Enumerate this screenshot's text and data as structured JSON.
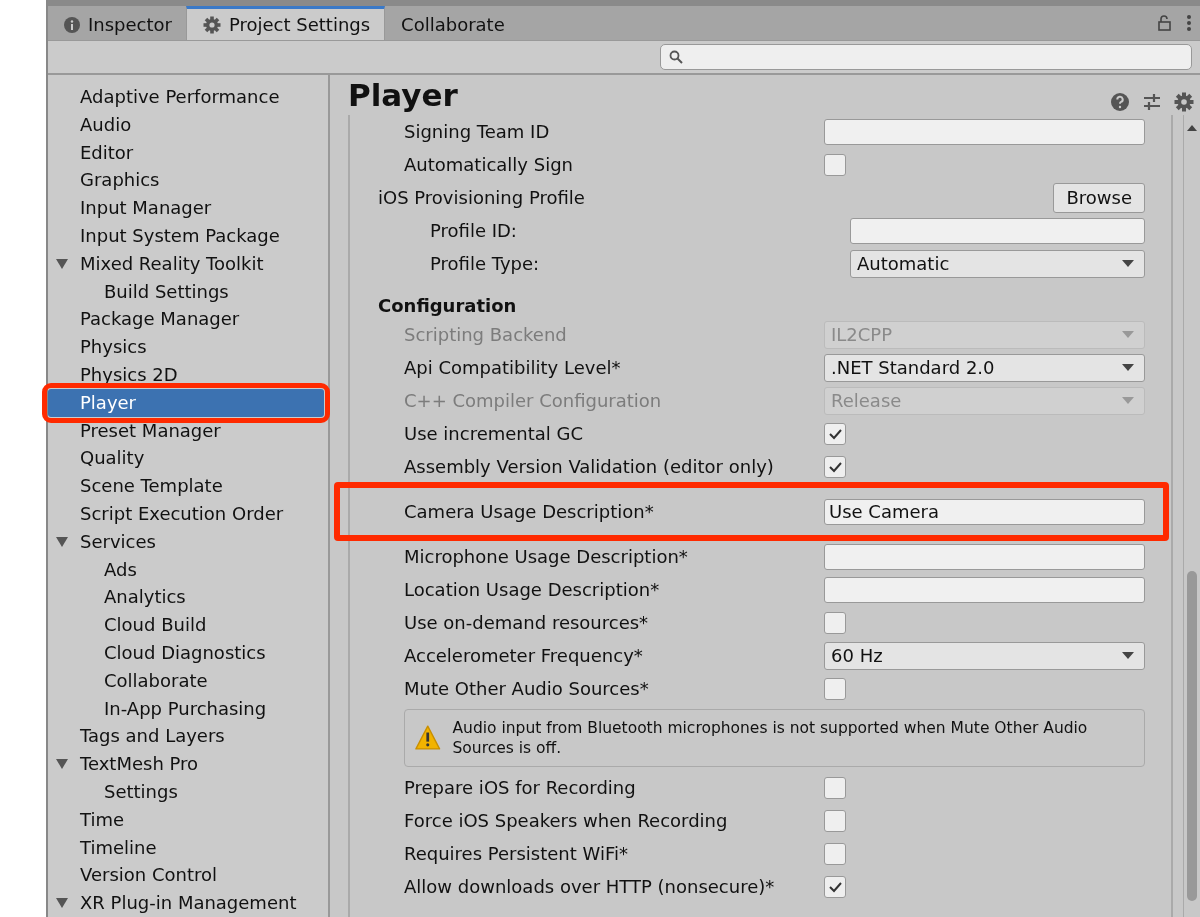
{
  "tabs": [
    {
      "label": "Inspector",
      "selected": false
    },
    {
      "label": "Project Settings",
      "selected": true
    },
    {
      "label": "Collaborate",
      "selected": false
    }
  ],
  "sidebar": {
    "items": [
      {
        "label": "Adaptive Performance",
        "selected": false
      },
      {
        "label": "Audio",
        "selected": false
      },
      {
        "label": "Editor",
        "selected": false
      },
      {
        "label": "Graphics",
        "selected": false
      },
      {
        "label": "Input Manager",
        "selected": false
      },
      {
        "label": "Input System Package",
        "selected": false
      },
      {
        "label": "Mixed Reality Toolkit",
        "selected": false,
        "expanded": true,
        "children": [
          {
            "label": "Build Settings",
            "selected": false
          }
        ]
      },
      {
        "label": "Package Manager",
        "selected": false
      },
      {
        "label": "Physics",
        "selected": false
      },
      {
        "label": "Physics 2D",
        "selected": false
      },
      {
        "label": "Player",
        "selected": true,
        "annotated": true
      },
      {
        "label": "Preset Manager",
        "selected": false
      },
      {
        "label": "Quality",
        "selected": false
      },
      {
        "label": "Scene Template",
        "selected": false
      },
      {
        "label": "Script Execution Order",
        "selected": false
      },
      {
        "label": "Services",
        "selected": false,
        "expanded": true,
        "children": [
          {
            "label": "Ads",
            "selected": false
          },
          {
            "label": "Analytics",
            "selected": false
          },
          {
            "label": "Cloud Build",
            "selected": false
          },
          {
            "label": "Cloud Diagnostics",
            "selected": false
          },
          {
            "label": "Collaborate",
            "selected": false
          },
          {
            "label": "In-App Purchasing",
            "selected": false
          }
        ]
      },
      {
        "label": "Tags and Layers",
        "selected": false
      },
      {
        "label": "TextMesh Pro",
        "selected": false,
        "expanded": true,
        "children": [
          {
            "label": "Settings",
            "selected": false
          }
        ]
      },
      {
        "label": "Time",
        "selected": false
      },
      {
        "label": "Timeline",
        "selected": false
      },
      {
        "label": "Version Control",
        "selected": false
      },
      {
        "label": "XR Plug-in Management",
        "selected": false,
        "expanded": true
      }
    ]
  },
  "panel": {
    "title": "Player",
    "rows": [
      {
        "kind": "field",
        "label": "Signing Team ID",
        "value": ""
      },
      {
        "kind": "checkbox",
        "label": "Automatically Sign",
        "checked": false
      },
      {
        "kind": "button",
        "label": "iOS Provisioning Profile",
        "button": "Browse"
      },
      {
        "kind": "field",
        "label": "Profile ID:",
        "value": ""
      },
      {
        "kind": "dropdown",
        "label": "Profile Type:",
        "value": "Automatic",
        "disabled": false
      },
      {
        "kind": "header",
        "label": "Configuration"
      },
      {
        "kind": "dropdown",
        "label": "Scripting Backend",
        "value": "IL2CPP",
        "disabled": true
      },
      {
        "kind": "dropdown",
        "label": "Api Compatibility Level*",
        "value": ".NET Standard 2.0",
        "disabled": false
      },
      {
        "kind": "dropdown",
        "label": "C++ Compiler Configuration",
        "value": "Release",
        "disabled": true
      },
      {
        "kind": "checkbox",
        "label": "Use incremental GC",
        "checked": true
      },
      {
        "kind": "checkbox",
        "label": "Assembly Version Validation (editor only)",
        "checked": true
      },
      {
        "kind": "field",
        "label": "Camera Usage Description*",
        "value": "Use Camera",
        "annotated": true
      },
      {
        "kind": "field",
        "label": "Microphone Usage Description*",
        "value": ""
      },
      {
        "kind": "field",
        "label": "Location Usage Description*",
        "value": ""
      },
      {
        "kind": "checkbox",
        "label": "Use on-demand resources*",
        "checked": false
      },
      {
        "kind": "dropdown",
        "label": "Accelerometer Frequency*",
        "value": "60 Hz",
        "disabled": false
      },
      {
        "kind": "checkbox",
        "label": "Mute Other Audio Sources*",
        "checked": false
      },
      {
        "kind": "warning",
        "text": "Audio input from Bluetooth microphones is not supported when Mute Other Audio Sources is off."
      },
      {
        "kind": "checkbox",
        "label": "Prepare iOS for Recording",
        "checked": false
      },
      {
        "kind": "checkbox",
        "label": "Force iOS Speakers when Recording",
        "checked": false
      },
      {
        "kind": "checkbox",
        "label": "Requires Persistent WiFi*",
        "checked": false
      },
      {
        "kind": "checkbox",
        "label": "Allow downloads over HTTP (nonsecure)*",
        "checked": true
      }
    ]
  }
}
